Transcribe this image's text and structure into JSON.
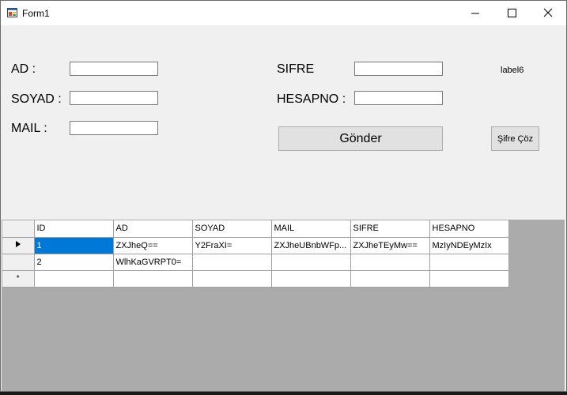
{
  "window": {
    "title": "Form1"
  },
  "form": {
    "ad_label": "AD :",
    "soyad_label": "SOYAD :",
    "mail_label": "MAIL :",
    "sifre_label": "SIFRE",
    "hesapno_label": "HESAPNO :",
    "label6": "label6",
    "ad_value": "",
    "soyad_value": "",
    "mail_value": "",
    "sifre_value": "",
    "hesapno_value": "",
    "gonder_button": "Gönder",
    "sifre_coz_button": "Şifre Çöz"
  },
  "grid": {
    "columns": [
      "ID",
      "AD",
      "SOYAD",
      "MAIL",
      "SIFRE",
      "HESAPNO"
    ],
    "rows": [
      [
        "1",
        "ZXJheQ==",
        "Y2FraXI=",
        "ZXJheUBnbWFp...",
        "ZXJheTEyMw==",
        "MzIyNDEyMzIx"
      ],
      [
        "2",
        "WlhKaGVRPT0=",
        "",
        "",
        "",
        ""
      ]
    ],
    "new_row_marker": "*"
  }
}
